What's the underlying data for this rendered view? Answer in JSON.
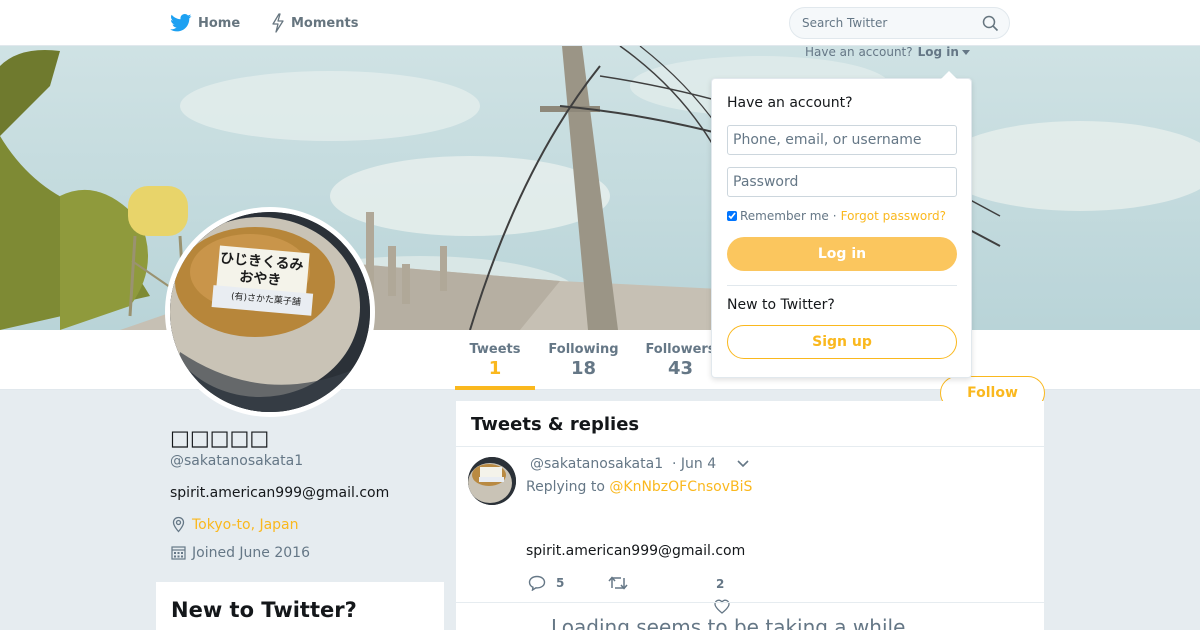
{
  "nav": {
    "home_label": "Home",
    "moments_label": "Moments",
    "search_placeholder": "Search Twitter"
  },
  "login_dropdown": {
    "prompt": "Have an account?",
    "login_link": "Log in",
    "title": "Have an account?",
    "username_placeholder": "Phone, email, or username",
    "password_placeholder": "Password",
    "remember_label": "Remember me",
    "separator": "·",
    "forgot_label": "Forgot password?",
    "login_button": "Log in",
    "new_label": "New to Twitter?",
    "signup_button": "Sign up"
  },
  "profile_nav": {
    "tweets_label": "Tweets",
    "tweets_count": "1",
    "following_label": "Following",
    "following_count": "18",
    "followers_label": "Followers",
    "followers_count": "43",
    "follow_button": "Follow"
  },
  "profile": {
    "display_name": "□□□□□",
    "handle": "@sakatanosakata1",
    "bio": "spirit.american999@gmail.com",
    "location": "Tokyo-to, Japan",
    "joined": "Joined June 2016",
    "avatar_label_line1": "ひじきくるみ",
    "avatar_label_line2": "おやき",
    "avatar_label_line3": "(有)さかた菓子舗"
  },
  "signup_box": {
    "title": "New to Twitter?"
  },
  "timeline": {
    "title": "Tweets & replies",
    "tweet": {
      "handle": "@sakatanosakata1",
      "date": "· Jun 4",
      "replying_prefix": "Replying to",
      "replying_to": "@KnNbzOFCnsovBiS",
      "body": "spirit.american999@gmail.com",
      "reply_count": "5",
      "like_count": "2"
    },
    "loading_text": "Loading seems to be taking a while."
  },
  "colors": {
    "accent": "#fab81e",
    "login_button_bg": "#fbc65e",
    "secondary_text": "#657786",
    "background": "#e6ecf0"
  }
}
